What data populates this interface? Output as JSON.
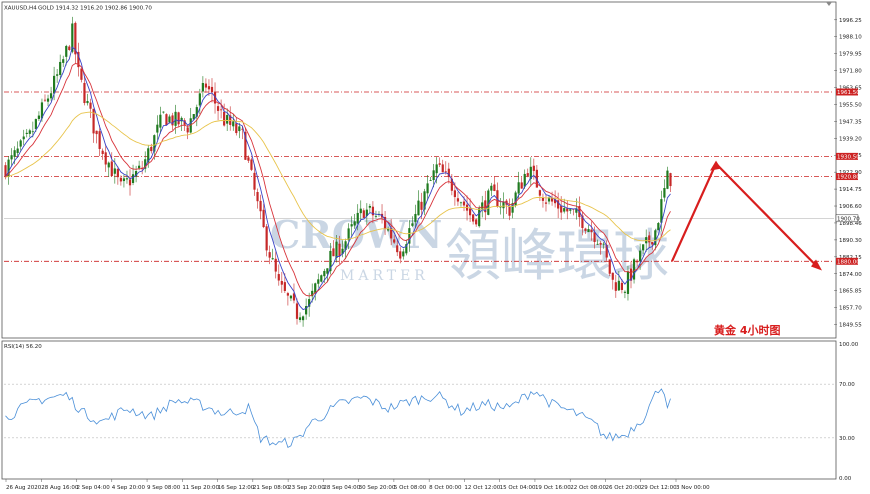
{
  "header": {
    "symbol_line": "XAUUSD,H4",
    "values_line": "GOLD 1914.32 1916.20 1902.86 1900.70",
    "rsi_line": "RSI(14) 56.20"
  },
  "watermark": {
    "latin": "CROWN",
    "sub": "MARTER",
    "cn": "領峰環球"
  },
  "annotation": "黄金 4小时图",
  "colors": {
    "bull": "#1f7a1f",
    "bear": "#c62828",
    "level_line": "#cc2222",
    "ma_blue": "#3a44c7",
    "ma_red": "#d8343b",
    "ma_yellow": "#e8c44c",
    "rsi": "#4a8fd8",
    "arrow": "#d81e1e"
  },
  "chart_data": [
    {
      "type": "line",
      "title": "XAUUSD,H4",
      "price_axis_ticks": [
        "1996.25",
        "1988.10",
        "1979.95",
        "1971.80",
        "1963.65",
        "1955.50",
        "1947.35",
        "1939.20",
        "1931.05",
        "1922.90",
        "1914.75",
        "1906.60",
        "1898.46",
        "1890.30",
        "1882.15",
        "1874.00",
        "1865.85",
        "1857.70",
        "1849.55"
      ],
      "ylim": [
        1845,
        2000
      ],
      "x_ticks": [
        "26 Aug 2020",
        "28 Aug 16:00",
        "2 Sep 04:00",
        "4 Sep 20:00",
        "9 Sep 08:00",
        "11 Sep 20:00",
        "16 Sep 12:00",
        "21 Sep 08:00",
        "23 Sep 20:00",
        "28 Sep 04:00",
        "30 Sep 20:00",
        "5 Oct 08:00",
        "8 Oct 00:00",
        "12 Oct 12:00",
        "15 Oct 04:00",
        "19 Oct 16:00",
        "22 Oct 08:00",
        "26 Oct 20:00",
        "29 Oct 12:00",
        "3 Nov 00:00"
      ],
      "levels": [
        {
          "value": 1961.5,
          "label": "1961.50"
        },
        {
          "value": 1930.5,
          "label": "1930.50"
        },
        {
          "value": 1920.8,
          "label": "1920.80"
        },
        {
          "value": 1880.0,
          "label": "1880.00"
        }
      ],
      "last_price_label": "1900.70",
      "series": [
        {
          "name": "Close",
          "anchors": [
            [
              0,
              1925
            ],
            [
              8,
              1940
            ],
            [
              18,
              1972
            ],
            [
              22,
              1990
            ],
            [
              24,
              1970
            ],
            [
              30,
              1940
            ],
            [
              38,
              1915
            ],
            [
              45,
              1925
            ],
            [
              52,
              1950
            ],
            [
              60,
              1945
            ],
            [
              66,
              1965
            ],
            [
              72,
              1948
            ],
            [
              78,
              1940
            ],
            [
              84,
              1900
            ],
            [
              90,
              1868
            ],
            [
              96,
              1855
            ],
            [
              100,
              1860
            ],
            [
              106,
              1880
            ],
            [
              112,
              1890
            ],
            [
              118,
              1905
            ],
            [
              124,
              1900
            ],
            [
              130,
              1885
            ],
            [
              136,
              1905
            ],
            [
              142,
              1925
            ],
            [
              148,
              1915
            ],
            [
              154,
              1900
            ],
            [
              160,
              1912
            ],
            [
              166,
              1905
            ],
            [
              172,
              1925
            ],
            [
              178,
              1910
            ],
            [
              184,
              1905
            ],
            [
              190,
              1900
            ],
            [
              196,
              1890
            ],
            [
              200,
              1870
            ],
            [
              204,
              1868
            ],
            [
              208,
              1880
            ],
            [
              214,
              1895
            ],
            [
              218,
              1920
            ]
          ]
        }
      ],
      "forecast_arrow": {
        "start": 1880,
        "peak": 1927,
        "end": 1877
      }
    },
    {
      "type": "line",
      "title": "RSI(14) 56.20",
      "ylim": [
        0,
        100
      ],
      "y_ticks": [
        "100.00",
        "70.00",
        "30.00",
        "0.00"
      ],
      "levels": [
        70,
        30
      ],
      "series": [
        {
          "name": "RSI(14)",
          "anchors": [
            [
              0,
              45
            ],
            [
              10,
              58
            ],
            [
              20,
              62
            ],
            [
              26,
              48
            ],
            [
              32,
              42
            ],
            [
              40,
              52
            ],
            [
              48,
              46
            ],
            [
              56,
              58
            ],
            [
              64,
              55
            ],
            [
              72,
              48
            ],
            [
              80,
              52
            ],
            [
              84,
              30
            ],
            [
              90,
              25
            ],
            [
              96,
              28
            ],
            [
              100,
              40
            ],
            [
              110,
              55
            ],
            [
              118,
              60
            ],
            [
              126,
              52
            ],
            [
              134,
              58
            ],
            [
              142,
              62
            ],
            [
              150,
              50
            ],
            [
              158,
              55
            ],
            [
              166,
              52
            ],
            [
              174,
              66
            ],
            [
              180,
              55
            ],
            [
              188,
              48
            ],
            [
              194,
              40
            ],
            [
              198,
              30
            ],
            [
              204,
              32
            ],
            [
              210,
              45
            ],
            [
              214,
              62
            ],
            [
              216,
              70
            ],
            [
              218,
              56
            ]
          ]
        }
      ]
    }
  ]
}
